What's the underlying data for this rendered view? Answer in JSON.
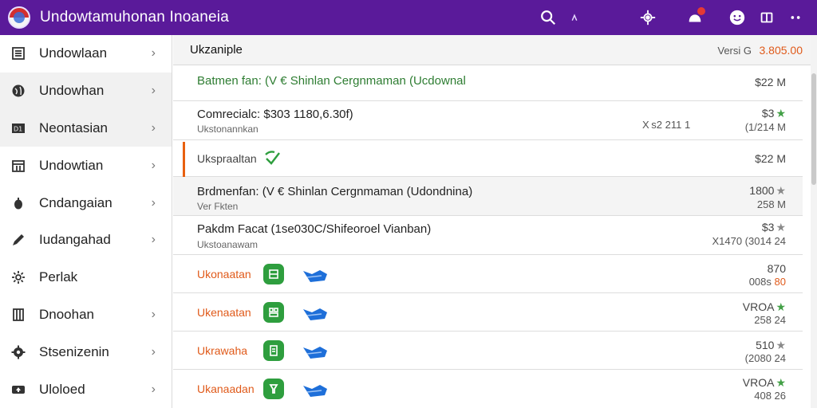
{
  "app": {
    "title": "Undowtamuhonan Inoaneia",
    "icons": [
      "search-icon",
      "chevron-icon",
      "settings-icon",
      "notifications-icon",
      "smiley-icon",
      "window-icon",
      "more-icon"
    ]
  },
  "sidebar": {
    "items": [
      {
        "label": "Undowlaan",
        "icon": "list-icon"
      },
      {
        "label": "Undowhan",
        "icon": "globe-icon"
      },
      {
        "label": "Neontasian",
        "icon": "media-icon"
      },
      {
        "label": "Undowtian",
        "icon": "calendar-icon"
      },
      {
        "label": "Cndangaian",
        "icon": "drop-icon"
      },
      {
        "label": "Iudangahad",
        "icon": "pen-icon"
      },
      {
        "label": "Perlak",
        "icon": "gear-icon"
      },
      {
        "label": "Dnoohan",
        "icon": "building-icon"
      },
      {
        "label": "Stsenizenin",
        "icon": "settings-icon"
      },
      {
        "label": "Uloloed",
        "icon": "upload-icon"
      }
    ],
    "chevron": "›"
  },
  "main": {
    "title": "Ukzaniple",
    "version_label": "Versi G",
    "version_value": "3.805.00",
    "rows": [
      {
        "title": "Batmen fan: (V € Shinlan Cergnmaman (Ucdownal",
        "value": "$22 M"
      },
      {
        "title": "Comrecialc: $303 1180,6.30f)",
        "sub": "Ukstonannkan",
        "mid": "X s2 211 1",
        "val1": "$3",
        "val2": "(1/214 M"
      },
      {
        "label": "Ukspraaltan",
        "value": "$22 M"
      },
      {
        "title": "Brdmenfan: (V € Shinlan Cergnmaman (Udondnina)",
        "sub": "Ver Fkten",
        "val1": "1800",
        "val2": "258 M"
      },
      {
        "title": "Pakdm Facat (1se030C/Shifeoroel Vianban)",
        "sub": "Ukstoanawam",
        "val1": "$3",
        "val2": "X1470 (3014 24"
      },
      {
        "label": "Ukonaatan",
        "val1": "870",
        "val2a": "008s",
        "val2b": "80"
      },
      {
        "label": "Ukenaatan",
        "val1": "VROA",
        "val2": "258 24"
      },
      {
        "label": "Ukrawaha",
        "val1": "510",
        "val2": "(2080 24"
      },
      {
        "label": "Ukanaadan",
        "val1": "VROA",
        "val2": "408 26"
      }
    ]
  },
  "colors": {
    "topbar": "#5a1a9a",
    "accent_orange": "#e05a1a",
    "green": "#2e9e3e",
    "blue": "#1e6fd9"
  }
}
